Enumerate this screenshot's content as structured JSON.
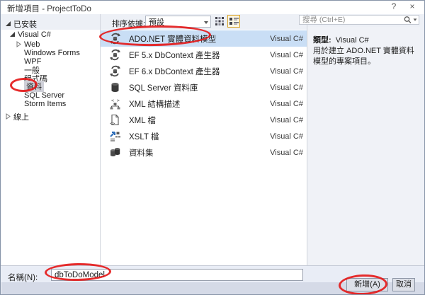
{
  "window": {
    "title": "新增項目 - ProjectToDo",
    "help_label": "?",
    "close_label": "×"
  },
  "sidebar": {
    "installed_label": "已安裝",
    "online_label": "線上",
    "tree": [
      {
        "label": "Visual C#",
        "level": 1,
        "state": "expanded"
      },
      {
        "label": "Web",
        "level": 2,
        "state": "collapsed"
      },
      {
        "label": "Windows Forms",
        "level": 2
      },
      {
        "label": "WPF",
        "level": 2
      },
      {
        "label": "一般",
        "level": 2
      },
      {
        "label": "程式碼",
        "level": 2
      },
      {
        "label": "資料",
        "level": 2,
        "selected": true,
        "annotated": true
      },
      {
        "label": "SQL Server",
        "level": 2
      },
      {
        "label": "Storm Items",
        "level": 2
      }
    ]
  },
  "toolbar": {
    "sort_label": "排序依據:",
    "sort_value": "預設",
    "view_modes": [
      "small-icons-view",
      "list-view"
    ],
    "active_view": "list-view"
  },
  "search": {
    "placeholder": "搜尋 (Ctrl+E)"
  },
  "list": {
    "items": [
      {
        "name": "ADO.NET 實體資料模型",
        "lang": "Visual C#",
        "icon": "entity-model",
        "selected": true,
        "annotated": true
      },
      {
        "name": "EF 5.x DbContext 產生器",
        "lang": "Visual C#",
        "icon": "entity-model"
      },
      {
        "name": "EF 6.x DbContext 產生器",
        "lang": "Visual C#",
        "icon": "entity-model"
      },
      {
        "name": "SQL Server 資料庫",
        "lang": "Visual C#",
        "icon": "database"
      },
      {
        "name": "XML 結構描述",
        "lang": "Visual C#",
        "icon": "xml-schema"
      },
      {
        "name": "XML 檔",
        "lang": "Visual C#",
        "icon": "xml-file"
      },
      {
        "name": "XSLT 檔",
        "lang": "Visual C#",
        "icon": "xslt-file"
      },
      {
        "name": "資料集",
        "lang": "Visual C#",
        "icon": "dataset"
      }
    ]
  },
  "info": {
    "type_label": "類型:",
    "type_value": "Visual C#",
    "description": "用於建立 ADO.NET 實體資料模型的專案項目。"
  },
  "footer": {
    "name_label": "名稱(N):",
    "name_value": "dbToDoModel",
    "add_label": "新增(A)",
    "cancel_label": "取消"
  },
  "annotations": {
    "color": "#e41a1a",
    "targets": [
      "sidebar-item-資料",
      "list-item-ADO.NET 實體資料模型",
      "name-input",
      "add-button"
    ]
  },
  "colors": {
    "selection_blue": "#c9def5",
    "selection_gray": "#cfd0d8",
    "view_button_active_border": "#d8a226",
    "window_border": "#8794a8"
  }
}
